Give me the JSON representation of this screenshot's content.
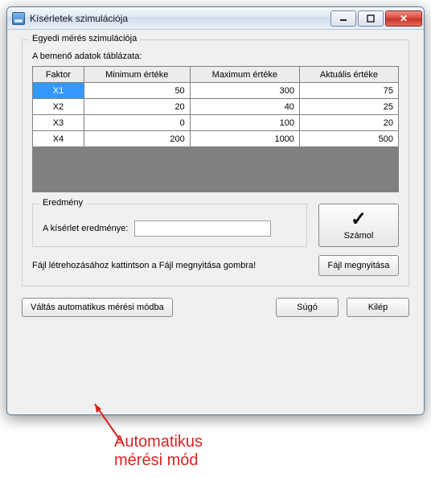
{
  "window": {
    "title": "Kísérletek szimulációja"
  },
  "group_legend": "Egyedi mérés szimulációja",
  "table_header_label": "A bemenő adatok táblázata:",
  "columns": {
    "factor": "Faktor",
    "min": "Minimum értéke",
    "max": "Maximum értéke",
    "current": "Aktuális értéke"
  },
  "rows": [
    {
      "factor": "X1",
      "min": 50,
      "max": 300,
      "current": 75,
      "selected": true
    },
    {
      "factor": "X2",
      "min": 20,
      "max": 40,
      "current": 25,
      "selected": false
    },
    {
      "factor": "X3",
      "min": 0,
      "max": 100,
      "current": 20,
      "selected": false
    },
    {
      "factor": "X4",
      "min": 200,
      "max": 1000,
      "current": 500,
      "selected": false
    }
  ],
  "result": {
    "legend": "Eredmény",
    "label": "A kísérlet eredménye:",
    "value": ""
  },
  "buttons": {
    "calc": "Számol",
    "file_hint": "Fájl létrehozásához kattintson a Fájl megnyitása gombra!",
    "file_open": "Fájl megnyitása",
    "mode_switch": "Váltás automatikus mérési módba",
    "help": "Súgó",
    "exit": "Kilép"
  },
  "annotation": {
    "line1": "Automatikus",
    "line2": "mérési mód",
    "color": "#d62422"
  }
}
